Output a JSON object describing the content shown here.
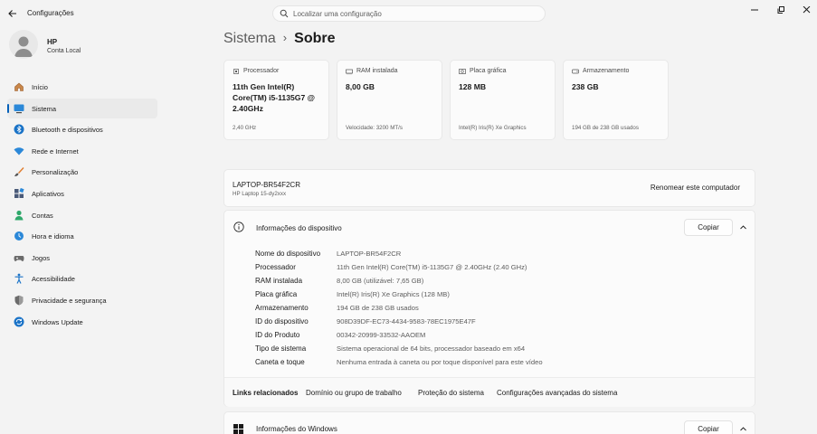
{
  "app": {
    "title": "Configurações",
    "back_icon": "arrow-left-icon"
  },
  "search": {
    "placeholder": "Localizar uma configuração",
    "icon": "search-icon"
  },
  "window_controls": [
    "minimize-icon",
    "restore-icon",
    "close-icon"
  ],
  "profile": {
    "name": "HP",
    "account_type": "Conta Local"
  },
  "sidebar": {
    "items": [
      {
        "label": "Início",
        "icon": "home-icon",
        "color": "#c07a3a"
      },
      {
        "label": "Sistema",
        "icon": "system-monitor-icon",
        "color": "#2b88d8",
        "active": true
      },
      {
        "label": "Bluetooth e dispositivos",
        "icon": "bluetooth-icon",
        "color": "#1a73c7"
      },
      {
        "label": "Rede e Internet",
        "icon": "wifi-icon",
        "color": "#2b88d8"
      },
      {
        "label": "Personalização",
        "icon": "brush-icon",
        "color": "#e07b2a"
      },
      {
        "label": "Aplicativos",
        "icon": "apps-icon",
        "color": "#4a5a78"
      },
      {
        "label": "Contas",
        "icon": "person-icon",
        "color": "#2fa86b"
      },
      {
        "label": "Hora e idioma",
        "icon": "globe-clock-icon",
        "color": "#2b88d8"
      },
      {
        "label": "Jogos",
        "icon": "gamepad-icon",
        "color": "#6b6b6b"
      },
      {
        "label": "Acessibilidade",
        "icon": "accessibility-icon",
        "color": "#1a73c7"
      },
      {
        "label": "Privacidade e segurança",
        "icon": "shield-icon",
        "color": "#6b6b6b"
      },
      {
        "label": "Windows Update",
        "icon": "update-icon",
        "color": "#1a73c7"
      }
    ]
  },
  "breadcrumb": {
    "parent": "Sistema",
    "separator": "›",
    "current": "Sobre"
  },
  "spec_cards": [
    {
      "title": "Processador",
      "icon": "cpu-icon",
      "value": "11th Gen Intel(R) Core(TM) i5-1135G7 @ 2.40GHz",
      "sub": "2,40 GHz"
    },
    {
      "title": "RAM instalada",
      "icon": "ram-icon",
      "value": "8,00 GB",
      "sub": "Velocidade: 3200 MT/s"
    },
    {
      "title": "Placa gráfica",
      "icon": "gpu-icon",
      "value": "128 MB",
      "sub": "Intel(R) Iris(R) Xe Graphics"
    },
    {
      "title": "Armazenamento",
      "icon": "storage-icon",
      "value": "238 GB",
      "sub": "194 GB de 238 GB usados"
    }
  ],
  "device": {
    "name": "LAPTOP-BR54F2CR",
    "model": "HP Laptop 15-dy2xxx",
    "rename_label": "Renomear este computador"
  },
  "device_info": {
    "title": "Informações do dispositivo",
    "copy_label": "Copiar",
    "rows": [
      {
        "key": "Nome do dispositivo",
        "value": "LAPTOP-BR54F2CR"
      },
      {
        "key": "Processador",
        "value": "11th Gen Intel(R) Core(TM) i5-1135G7 @ 2.40GHz (2.40 GHz)"
      },
      {
        "key": "RAM instalada",
        "value": "8,00 GB (utilizável: 7,65 GB)"
      },
      {
        "key": "Placa gráfica",
        "value": "Intel(R) Iris(R) Xe Graphics (128 MB)"
      },
      {
        "key": "Armazenamento",
        "value": "194 GB de 238 GB usados"
      },
      {
        "key": "ID do dispositivo",
        "value": "908D39DF-EC73-4434-9583-78EC1975E47F"
      },
      {
        "key": "ID do Produto",
        "value": "00342-20999-33532-AAOEM"
      },
      {
        "key": "Tipo de sistema",
        "value": "Sistema operacional de 64 bits, processador baseado em x64"
      },
      {
        "key": "Caneta e toque",
        "value": "Nenhuma entrada à caneta ou por toque disponível para este vídeo"
      }
    ],
    "related_label": "Links relacionados",
    "related_links": [
      "Domínio ou grupo de trabalho",
      "Proteção do sistema",
      "Configurações avançadas do sistema"
    ]
  },
  "windows_info": {
    "title": "Informações do Windows",
    "copy_label": "Copiar"
  }
}
